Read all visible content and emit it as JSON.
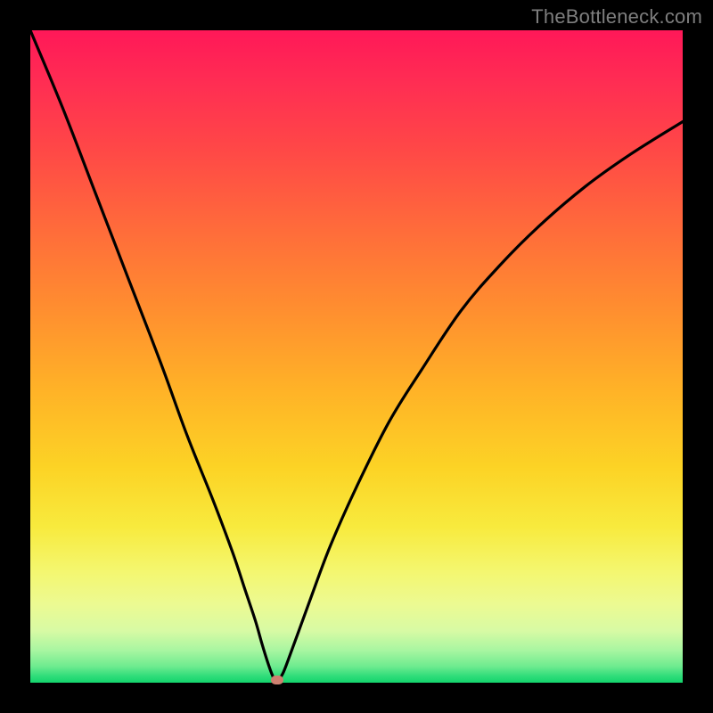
{
  "watermark": "TheBottleneck.com",
  "colors": {
    "background": "#000000",
    "curve": "#000000",
    "marker": "#cf8070"
  },
  "chart_data": {
    "type": "line",
    "title": "",
    "xlabel": "",
    "ylabel": "",
    "xlim": [
      0,
      100
    ],
    "ylim": [
      0,
      100
    ],
    "grid": false,
    "axes_visible": false,
    "series": [
      {
        "name": "bottleneck-curve",
        "x": [
          0,
          5,
          10,
          15,
          20,
          24,
          28,
          31,
          33,
          34.5,
          35.5,
          36.3,
          37,
          37.5,
          38,
          38.7,
          39.5,
          41,
          43,
          46,
          50,
          55,
          60,
          66,
          72,
          78,
          85,
          92,
          100
        ],
        "values": [
          100,
          88,
          75,
          62,
          49,
          38,
          28,
          20,
          14,
          9.5,
          6,
          3.4,
          1.4,
          0.4,
          0.4,
          1.4,
          3.4,
          7.5,
          13,
          21,
          30,
          40,
          48,
          57,
          64,
          70,
          76,
          81,
          86
        ]
      }
    ],
    "annotations": [
      {
        "name": "minimum-marker",
        "x": 37.8,
        "y": 0.4
      }
    ],
    "background_gradient": {
      "direction": "vertical",
      "stops": [
        {
          "pos": 0.0,
          "color": "#ff1858"
        },
        {
          "pos": 0.3,
          "color": "#ff6a3b"
        },
        {
          "pos": 0.55,
          "color": "#ffb227"
        },
        {
          "pos": 0.76,
          "color": "#f8ea3d"
        },
        {
          "pos": 0.92,
          "color": "#d8faa4"
        },
        {
          "pos": 1.0,
          "color": "#14d46c"
        }
      ]
    }
  }
}
